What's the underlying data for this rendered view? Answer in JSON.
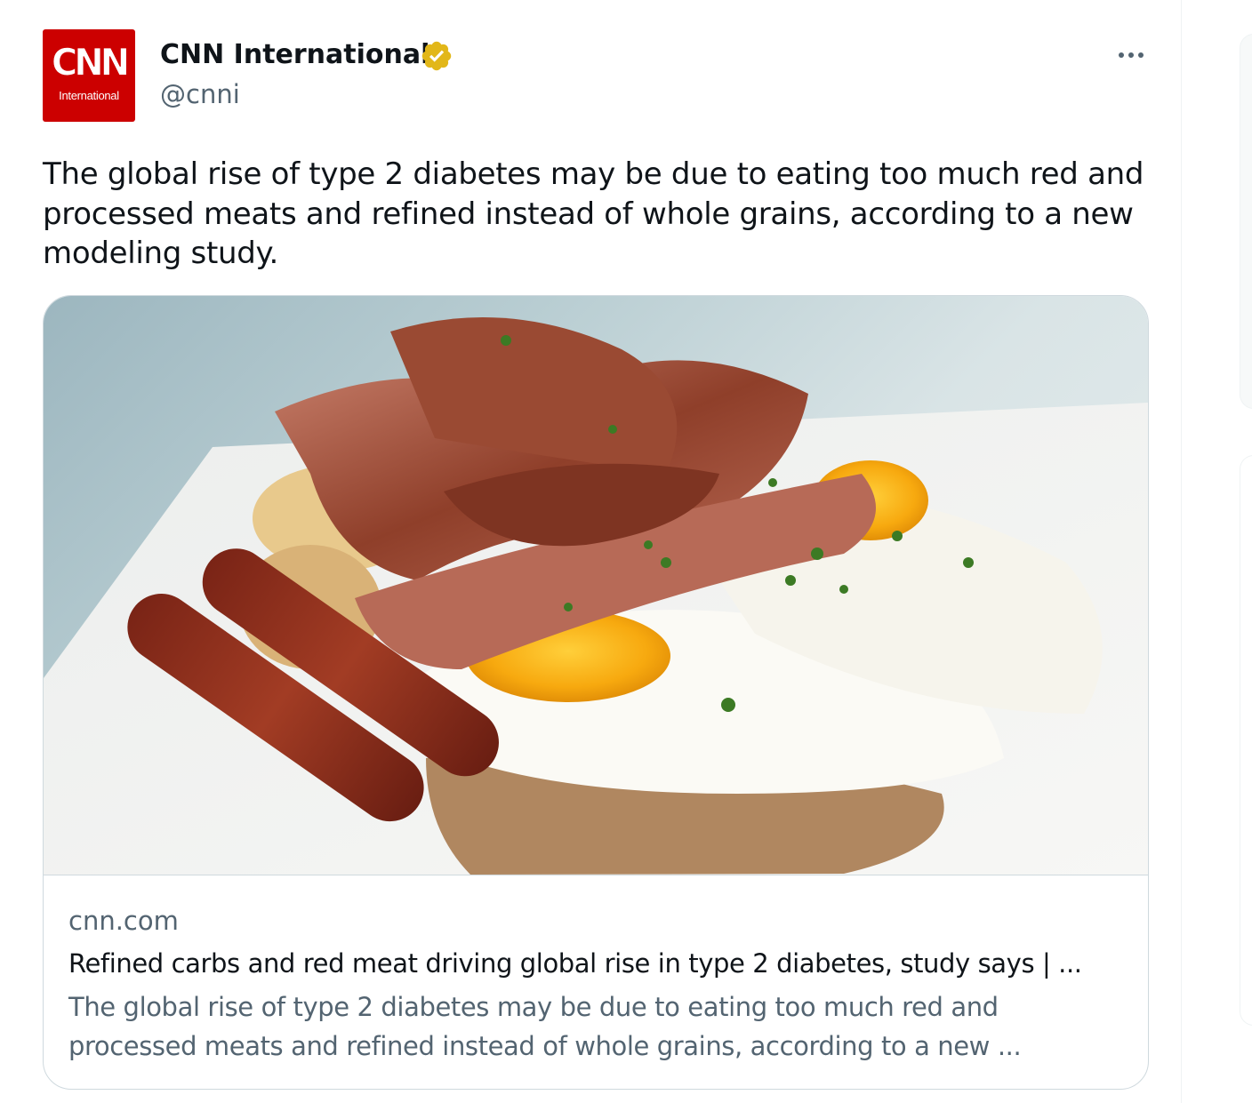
{
  "tweet": {
    "author": {
      "logo_text": "CNN",
      "logo_subtext": "International",
      "display_name": "CNN International",
      "handle": "@cnni",
      "verified_color": "#e2b719"
    },
    "more_icon": "more-options-icon",
    "text": "The global rise of type 2 diabetes may be due to eating too much red and processed meats and refined instead of whole grains, according to a new modeling study.",
    "card": {
      "image": "Breakfast plate with bacon, fried eggs, sausages and toast",
      "domain": "cnn.com",
      "title": "Refined carbs and red meat driving global rise in type 2 diabetes, study says | ...",
      "description": "The global rise of type 2 diabetes may be due to eating too much red and processed meats and refined instead of whole grains, according to a new ..."
    }
  },
  "colors": {
    "brand_red": "#cc0000",
    "text_primary": "#0f1419",
    "text_secondary": "#536471",
    "border": "#cfd9de"
  }
}
